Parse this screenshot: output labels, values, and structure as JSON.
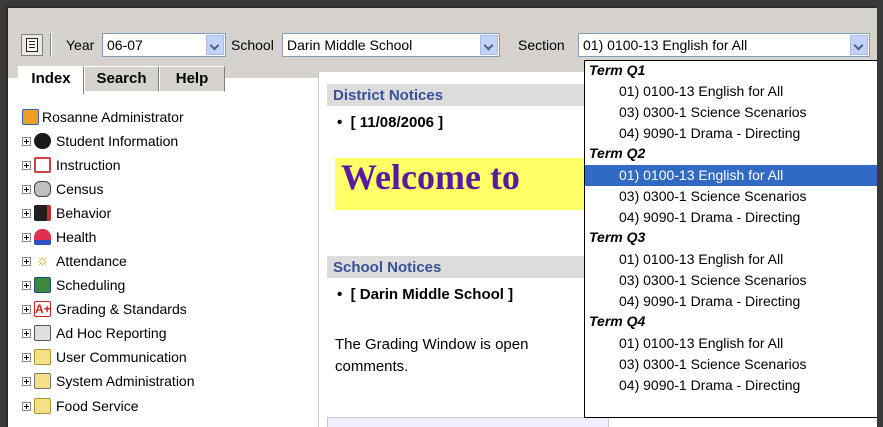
{
  "toolbar": {
    "year_label": "Year",
    "year_value": "06-07",
    "school_label": "School",
    "school_value": "Darin Middle School",
    "section_label": "Section",
    "section_value": "01) 0100-13 English for All"
  },
  "tabs": [
    {
      "label": "Index",
      "active": true
    },
    {
      "label": "Search",
      "active": false
    },
    {
      "label": "Help",
      "active": false
    }
  ],
  "tree": {
    "root": {
      "label": "Rosanne Administrator",
      "icon": "user-admin-icon"
    },
    "items": [
      {
        "label": "Student Information",
        "icon": "student-icon"
      },
      {
        "label": "Instruction",
        "icon": "instruction-icon"
      },
      {
        "label": "Census",
        "icon": "census-icon"
      },
      {
        "label": "Behavior",
        "icon": "behavior-icon"
      },
      {
        "label": "Health",
        "icon": "health-icon"
      },
      {
        "label": "Attendance",
        "icon": "attendance-icon"
      },
      {
        "label": "Scheduling",
        "icon": "scheduling-icon"
      },
      {
        "label": "Grading & Standards",
        "icon": "grading-icon"
      },
      {
        "label": "Ad Hoc Reporting",
        "icon": "report-icon"
      },
      {
        "label": "User Communication",
        "icon": "folder-icon"
      },
      {
        "label": "System Administration",
        "icon": "system-admin-icon"
      },
      {
        "label": "Food Service",
        "icon": "folder-icon"
      }
    ]
  },
  "district_notices": {
    "header": "District Notices",
    "date": "[ 11/08/2006 ]",
    "welcome": "Welcome to"
  },
  "school_notices": {
    "header": "School Notices",
    "school": "[ Darin Middle School ]",
    "body_line1": "The Grading Window is open",
    "body_line2": "comments."
  },
  "section_dropdown": {
    "groups": [
      {
        "term": "Term Q1",
        "options": [
          "01) 0100-13 English for All",
          "03) 0300-1 Science Scenarios",
          "04) 9090-1 Drama - Directing"
        ]
      },
      {
        "term": "Term Q2",
        "options": [
          "01) 0100-13 English for All",
          "03) 0300-1 Science Scenarios",
          "04) 9090-1 Drama - Directing"
        ]
      },
      {
        "term": "Term Q3",
        "options": [
          "01) 0100-13 English for All",
          "03) 0300-1 Science Scenarios",
          "04) 9090-1 Drama - Directing"
        ]
      },
      {
        "term": "Term Q4",
        "options": [
          "01) 0100-13 English for All",
          "03) 0300-1 Science Scenarios",
          "04) 9090-1 Drama - Directing"
        ]
      }
    ],
    "selected": "Term Q2 / 01) 0100-13 English for All"
  },
  "colors": {
    "selection": "#316ac5",
    "welcome_bg": "#ffff66",
    "welcome_text": "#5a1aa0",
    "panel_header_text": "#38529a"
  }
}
